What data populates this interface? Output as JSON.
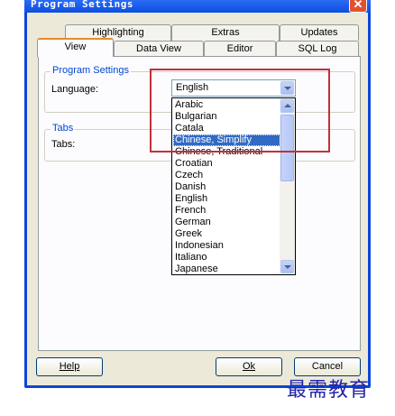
{
  "window": {
    "title": "Program Settings",
    "close_glyph": "✕"
  },
  "tabs_row_back": [
    "Highlighting",
    "Extras",
    "Updates"
  ],
  "tabs_row_front": [
    "View",
    "Data View",
    "Editor",
    "SQL Log"
  ],
  "program_settings": {
    "legend": "Program Settings",
    "language_label": "Language:",
    "language_value": "English"
  },
  "tabs_group": {
    "legend": "Tabs",
    "tabs_label": "Tabs:"
  },
  "language_options": [
    "Arabic",
    "Bulgarian",
    "Catala",
    "Chinese, Simplify",
    "Chinese, Traditional",
    "Croatian",
    "Czech",
    "Danish",
    "English",
    "French",
    "German",
    "Greek",
    "Indonesian",
    "Italiano",
    "Japanese"
  ],
  "selected_option_index": 3,
  "buttons": {
    "help": "Help",
    "ok": "Ok",
    "cancel": "Cancel"
  },
  "watermark": "最需教育",
  "colors": {
    "highlight_box": "#c0313b",
    "selection": "#316ac5",
    "title_bar": "#0c4fe0"
  }
}
